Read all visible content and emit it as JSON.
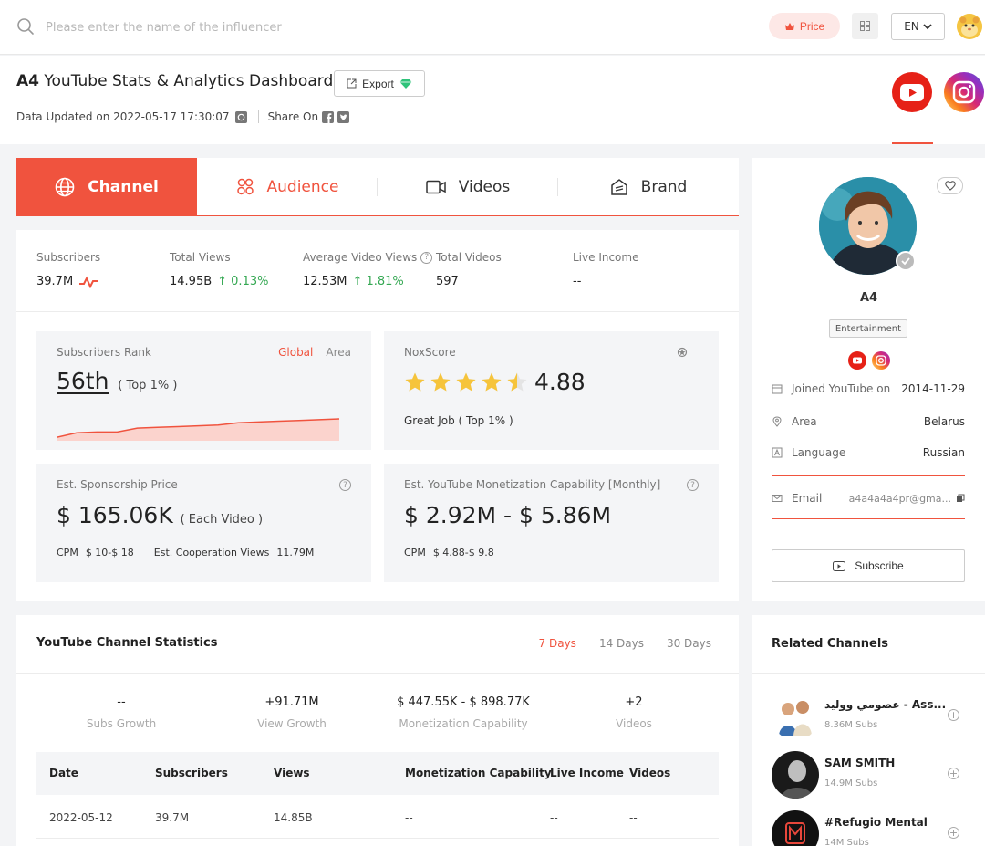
{
  "search": {
    "placeholder": "Please enter the name of the influencer"
  },
  "topbar": {
    "price_label": "Price",
    "lang_label": "EN"
  },
  "header": {
    "title_name": "A4",
    "title_rest": "YouTube Stats & Analytics Dashboard",
    "export_label": "Export",
    "updated_text": "Data Updated on 2022-05-17 17:30:07",
    "share_label": "Share On"
  },
  "tabs": [
    {
      "label": "Channel"
    },
    {
      "label": "Audience"
    },
    {
      "label": "Videos"
    },
    {
      "label": "Brand"
    }
  ],
  "stats": {
    "subscribers": {
      "label": "Subscribers",
      "value": "39.7M"
    },
    "total_views": {
      "label": "Total Views",
      "value": "14.95B",
      "change": "↑ 0.13%"
    },
    "avg_views": {
      "label": "Average Video Views",
      "value": "12.53M",
      "change": "↑ 1.81%"
    },
    "total_videos": {
      "label": "Total Videos",
      "value": "597"
    },
    "live_income": {
      "label": "Live Income",
      "value": "--"
    }
  },
  "rank_card": {
    "label": "Subscribers Rank",
    "global": "Global",
    "area": "Area",
    "rank": "56th",
    "top": "( Top 1% )",
    "trend": [
      2,
      8,
      9,
      9,
      14,
      15,
      16,
      17,
      18,
      21,
      22,
      23,
      24,
      25,
      26
    ]
  },
  "nox_card": {
    "label": "NoxScore",
    "score": "4.88",
    "score_value": 4.88,
    "comment": "Great Job ( Top 1% )"
  },
  "sponsor_card": {
    "label": "Est. Sponsorship Price",
    "price": "$ 165.06K",
    "unit": "( Each Video )",
    "cpm_label": "CPM",
    "cpm_value": "$ 10-$ 18",
    "coop_label": "Est. Cooperation Views",
    "coop_value": "11.79M"
  },
  "monetize_card": {
    "label": "Est. YouTube Monetization Capability [Monthly]",
    "range": "$ 2.92M - $ 5.86M",
    "cpm_label": "CPM",
    "cpm_value": "$ 4.88-$ 9.8"
  },
  "profile": {
    "name": "A4",
    "category": "Entertainment",
    "joined_label": "Joined YouTube on",
    "joined_value": "2014-11-29",
    "area_label": "Area",
    "area_value": "Belarus",
    "language_label": "Language",
    "language_value": "Russian",
    "email_label": "Email",
    "email_value": "a4a4a4a4pr@gma...",
    "subscribe_label": "Subscribe"
  },
  "channel_stats": {
    "title": "YouTube Channel Statistics",
    "day_tabs": [
      "7 Days",
      "14 Days",
      "30 Days"
    ],
    "summary": [
      {
        "value": "--",
        "label": "Subs Growth"
      },
      {
        "value": "+91.71M",
        "label": "View Growth"
      },
      {
        "value": "$ 447.55K - $ 898.77K",
        "label": "Monetization Capability"
      },
      {
        "value": "+2",
        "label": "Videos"
      }
    ],
    "columns": [
      "Date",
      "Subscribers",
      "Views",
      "Monetization Capability",
      "Live Income",
      "Videos"
    ],
    "rows": [
      [
        "2022-05-12",
        "39.7M",
        "14.85B",
        "--",
        "--",
        "--"
      ]
    ]
  },
  "related": {
    "title": "Related Channels",
    "items": [
      {
        "name": "عصومي ووليد - Ass...",
        "subs": "8.36M Subs"
      },
      {
        "name": "SAM SMITH",
        "subs": "14.9M Subs"
      },
      {
        "name": "#Refugio Mental",
        "subs": "14M Subs"
      }
    ]
  },
  "colors": {
    "accent": "#f0533e",
    "positive": "#35a853",
    "star": "#f6c43b"
  }
}
